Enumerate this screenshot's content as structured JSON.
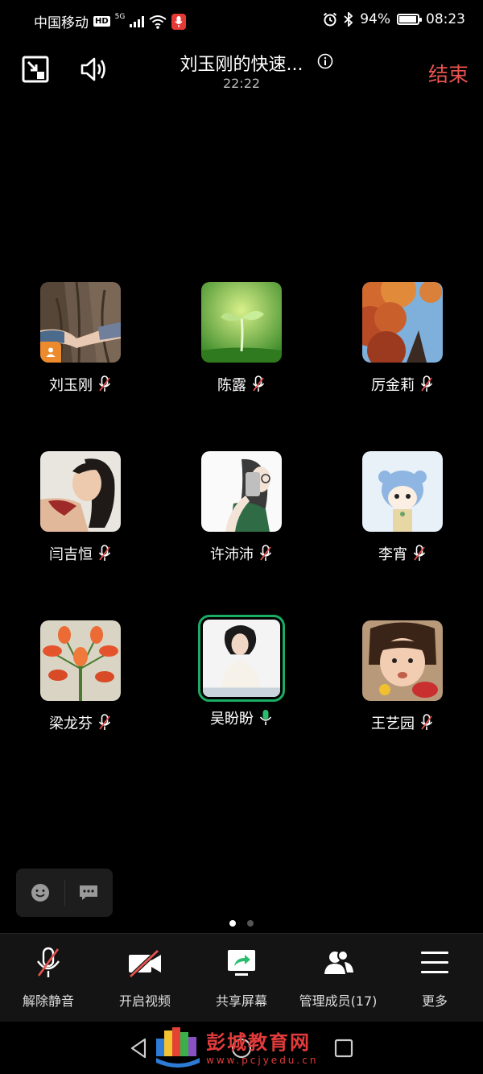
{
  "status_bar": {
    "carrier": "中国移动",
    "hd_badge": "HD",
    "network": "5G",
    "battery_percent": "94%",
    "battery_level": 0.94,
    "time": "08:23"
  },
  "top_bar": {
    "meeting_title": "刘玉刚的快速...",
    "timer": "22:22",
    "end_label": "结束",
    "end_color": "#e85450"
  },
  "participants": [
    {
      "name": "刘玉刚",
      "muted": true,
      "host": true,
      "avatar": "avatar-hands-on-tree"
    },
    {
      "name": "陈露",
      "muted": true,
      "avatar": "avatar-sprout"
    },
    {
      "name": "厉金莉",
      "muted": true,
      "avatar": "avatar-autumn-leaves"
    },
    {
      "name": "闫吉恒",
      "muted": true,
      "avatar": "avatar-woman-portrait"
    },
    {
      "name": "许沛沛",
      "muted": true,
      "avatar": "avatar-girl-with-phone"
    },
    {
      "name": "李宵",
      "muted": true,
      "avatar": "avatar-anime-girl"
    },
    {
      "name": "梁龙芬",
      "muted": true,
      "avatar": "avatar-red-flowers"
    },
    {
      "name": "吴盼盼",
      "muted": false,
      "speaking": true,
      "avatar": "avatar-woman-white-sweater"
    },
    {
      "name": "王艺园",
      "muted": true,
      "avatar": "avatar-child-eating"
    }
  ],
  "page_indicator": {
    "current": 1,
    "total": 2
  },
  "toolbar": {
    "unmute_label": "解除静音",
    "video_label": "开启视频",
    "share_label": "共享屏幕",
    "members_label": "管理成员(17)",
    "more_label": "更多"
  },
  "watermark": {
    "title": "彭城教育网",
    "url": "www.pcjyedu.cn"
  },
  "colors": {
    "speaking_border": "#1aad63",
    "host_badge": "#ec8a2e",
    "muted_slash": "#e85450",
    "share_arrow": "#2bbd6e"
  }
}
